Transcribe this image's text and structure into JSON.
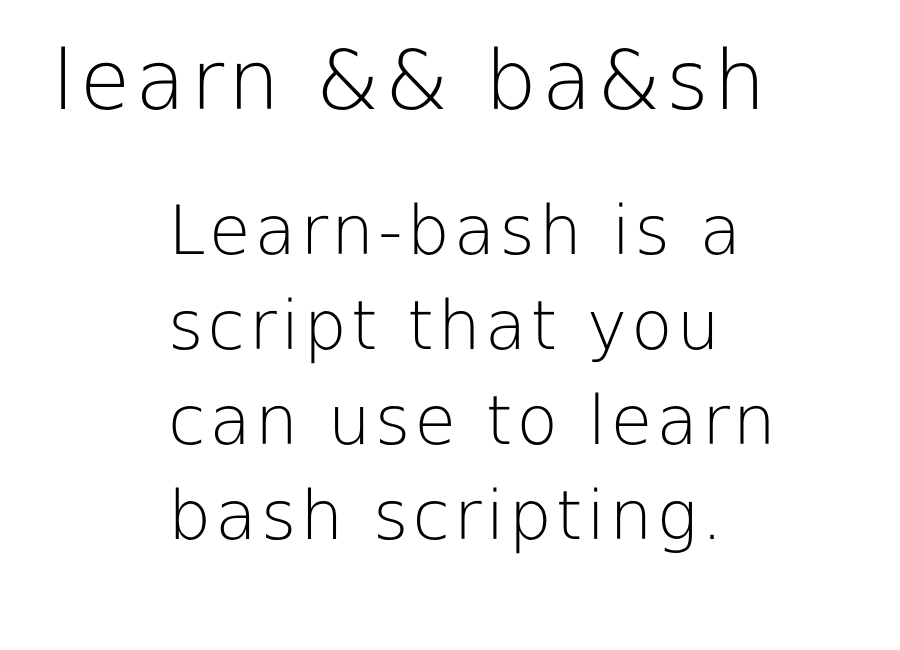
{
  "title": "learn && ba&sh",
  "description_lines": [
    "Learn-bash is a",
    "script that you",
    "can use to learn",
    "bash scripting."
  ]
}
